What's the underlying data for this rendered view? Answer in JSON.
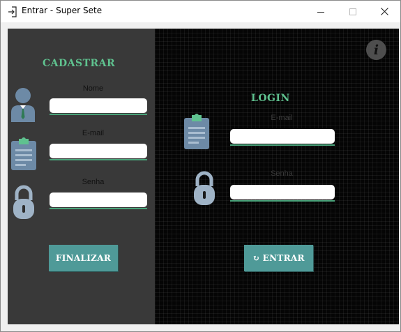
{
  "window": {
    "title": "Entrar - Super Sete",
    "icon": "login-arrow-icon"
  },
  "register": {
    "heading": "CADASTRAR",
    "name_label": "Nome",
    "email_label": "E-mail",
    "password_label": "Senha",
    "submit_label": "FINALIZAR",
    "name_value": "",
    "email_value": "",
    "password_value": ""
  },
  "login": {
    "heading": "LOGIN",
    "email_label": "E-mail",
    "password_label": "Senha",
    "submit_icon": "↻",
    "submit_label": "ENTRAR",
    "email_value": "",
    "password_value": ""
  },
  "info_glyph": "i",
  "colors": {
    "accent_green": "#5fc28f",
    "button_teal": "#4f9a98",
    "left_panel": "#393939",
    "right_panel": "#050505"
  }
}
